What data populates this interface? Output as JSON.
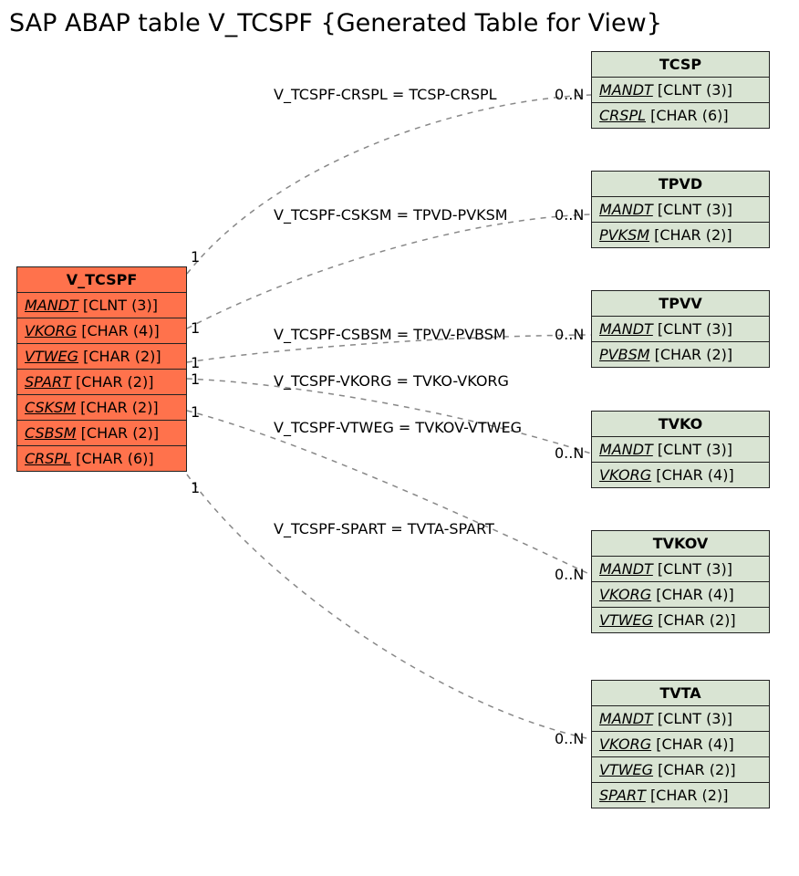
{
  "title": "SAP ABAP table V_TCSPF {Generated Table for View}",
  "mainEntity": {
    "name": "V_TCSPF",
    "fields": [
      {
        "key": "MANDT",
        "type": "[CLNT (3)]"
      },
      {
        "key": "VKORG",
        "type": "[CHAR (4)]"
      },
      {
        "key": "VTWEG",
        "type": "[CHAR (2)]"
      },
      {
        "key": "SPART",
        "type": "[CHAR (2)]"
      },
      {
        "key": "CSKSM",
        "type": "[CHAR (2)]"
      },
      {
        "key": "CSBSM",
        "type": "[CHAR (2)]"
      },
      {
        "key": "CRSPL",
        "type": "[CHAR (6)]"
      }
    ]
  },
  "targets": [
    {
      "name": "TCSP",
      "fields": [
        {
          "key": "MANDT",
          "type": "[CLNT (3)]"
        },
        {
          "key": "CRSPL",
          "type": "[CHAR (6)]"
        }
      ]
    },
    {
      "name": "TPVD",
      "fields": [
        {
          "key": "MANDT",
          "type": "[CLNT (3)]"
        },
        {
          "key": "PVKSM",
          "type": "[CHAR (2)]"
        }
      ]
    },
    {
      "name": "TPVV",
      "fields": [
        {
          "key": "MANDT",
          "type": "[CLNT (3)]"
        },
        {
          "key": "PVBSM",
          "type": "[CHAR (2)]"
        }
      ]
    },
    {
      "name": "TVKO",
      "fields": [
        {
          "key": "MANDT",
          "type": "[CLNT (3)]"
        },
        {
          "key": "VKORG",
          "type": "[CHAR (4)]"
        }
      ]
    },
    {
      "name": "TVKOV",
      "fields": [
        {
          "key": "MANDT",
          "type": "[CLNT (3)]"
        },
        {
          "key": "VKORG",
          "type": "[CHAR (4)]"
        },
        {
          "key": "VTWEG",
          "type": "[CHAR (2)]"
        }
      ]
    },
    {
      "name": "TVTA",
      "fields": [
        {
          "key": "MANDT",
          "type": "[CLNT (3)]"
        },
        {
          "key": "VKORG",
          "type": "[CHAR (4)]"
        },
        {
          "key": "VTWEG",
          "type": "[CHAR (2)]"
        },
        {
          "key": "SPART",
          "type": "[CHAR (2)]"
        }
      ]
    }
  ],
  "relations": [
    {
      "label": "V_TCSPF-CRSPL = TCSP-CRSPL",
      "left": "1",
      "right": "0..N"
    },
    {
      "label": "V_TCSPF-CSKSM = TPVD-PVKSM",
      "left": "1",
      "right": "0..N"
    },
    {
      "label": "V_TCSPF-CSBSM = TPVV-PVBSM",
      "left": "1",
      "right": "0..N"
    },
    {
      "label": "V_TCSPF-VKORG = TVKO-VKORG",
      "left": "1",
      "right": "0..N"
    },
    {
      "label": "V_TCSPF-VTWEG = TVKOV-VTWEG",
      "left": "1",
      "right": "0..N"
    },
    {
      "label": "V_TCSPF-SPART = TVTA-SPART",
      "left": "1",
      "right": "0..N"
    }
  ]
}
